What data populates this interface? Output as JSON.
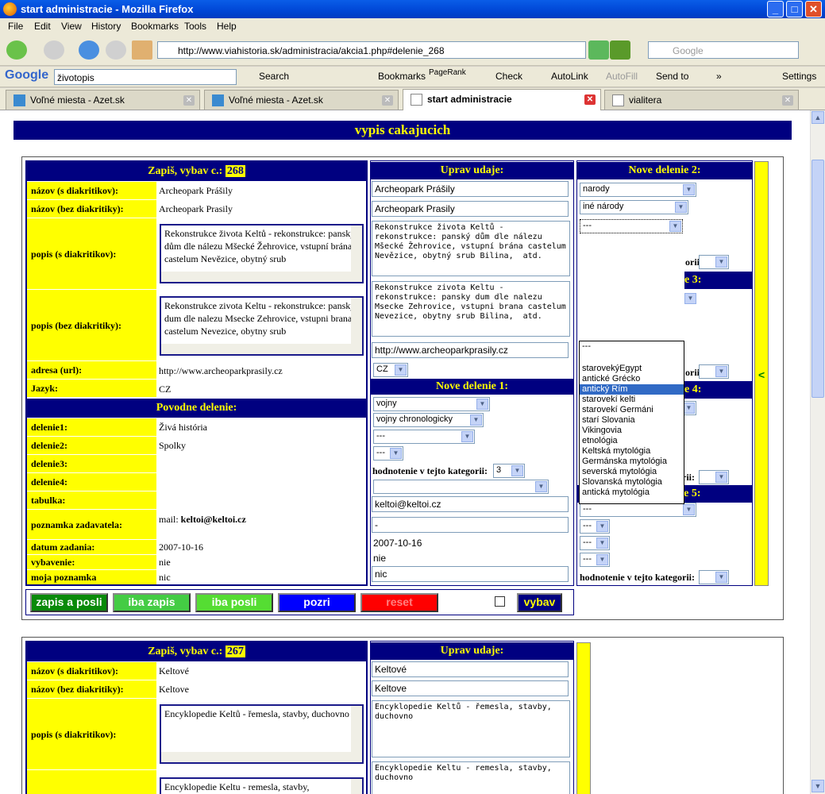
{
  "window": {
    "title": "start administracie - Mozilla Firefox"
  },
  "menu": [
    "File",
    "Edit",
    "View",
    "History",
    "Bookmarks",
    "Tools",
    "Help"
  ],
  "url": "http://www.viahistoria.sk/administracia/akcia1.php#delenie_268",
  "search_placeholder": "Google",
  "gtoolbar": {
    "query": "životopis",
    "search": "Search",
    "bookmarks": "Bookmarks",
    "pagerank": "PageRank",
    "check": "Check",
    "autolink": "AutoLink",
    "autofill": "AutoFill",
    "sendto": "Send to",
    "more": "»",
    "settings": "Settings"
  },
  "tabs": [
    "Voľné miesta - Azet.sk",
    "Voľné miesta - Azet.sk",
    "start administracie",
    "vialitera"
  ],
  "page": {
    "header": "vypis cakajucich"
  },
  "rec1": {
    "head_label": "Zapiš, vybav c.:",
    "num": "268",
    "l_nazov": "názov (s diakritikov):",
    "v_nazov": "Archeopark Prášily",
    "l_nazov2": "názov (bez diakritiky):",
    "v_nazov2": "Archeopark Prasily",
    "l_popis": "popis (s diakritikov):",
    "v_popis": "Rekonstrukce života Keltů - rekonstrukce: panský dům dle nálezu Mšecké Žehrovice, vstupní brána castelum Nevězice, obytný srub",
    "l_popis2": "popis (bez diakritiky):",
    "v_popis2": "Rekonstrukce zivota Keltu - rekonstrukce: pansky dum dle nalezu Msecke Zehrovice, vstupni brana castelum Nevezice, obytny srub",
    "l_url": "adresa (url):",
    "v_url": "http://www.archeoparkprasily.cz",
    "l_jazyk": "Jazyk:",
    "v_jazyk": "CZ",
    "povodne": "Povodne delenie:",
    "l_d1": "delenie1:",
    "v_d1": "Živá história",
    "l_d2": "delenie2:",
    "v_d2": "Spolky",
    "l_d3": "delenie3:",
    "l_d4": "delenie4:",
    "l_tab": "tabulka:",
    "l_pozn": "poznamka zadavatela:",
    "v_pozn_pre": "mail:",
    "v_pozn_mail": "keltoi@keltoi.cz",
    "l_datum": "datum zadania:",
    "v_datum": "2007-10-16",
    "l_vyb": "vybavenie:",
    "v_vyb": "nie",
    "l_moja": "moja poznamka",
    "v_moja": "nic",
    "uprav": "Uprav udaje:",
    "e_nazov": "Archeopark Prášily",
    "e_nazov2": "Archeopark Prasily",
    "e_popis": "Rekonstrukce života Keltů - rekonstrukce: panský dům dle nálezu Mšecké Žehrovice, vstupní brána castelum Nevězice, obytný srub Bilina,  atd.",
    "e_popis2": "Rekonstrukce zivota Keltu - rekonstrukce: pansky dum dle nalezu Msecke Zehrovice, vstupni brana castelum Nevezice, obytny srub Bilina,  atd.",
    "e_url": "http://www.archeoparkprasily.cz",
    "e_jazyk": "CZ",
    "nd1": "Nove delenie 1:",
    "nd1_s1": "vojny",
    "nd1_s2": "vojny chronologicky",
    "nd1_s3": "---",
    "nd1_s4": "---",
    "hodn": "hodnotenie v tejto kategorii:",
    "hodn_val": "3",
    "e_mail": "keltoi@keltoi.cz",
    "e_dash": "-",
    "e_datum": "2007-10-16",
    "e_vyb": "nie",
    "e_moja": "nic",
    "nd2": "Nove delenie 2:",
    "nd2_s1": "narody",
    "nd2_s2": "iné národy",
    "nd2_s3": "---",
    "nd3_partial": "e 3:",
    "nd4_partial": "e 4:",
    "hodn_partial": "orii:",
    "nd4_s1": "---",
    "nd4_s2": "---",
    "nd4_s3": "---",
    "nd4_s4": "---",
    "nd5": "Nove delenie 5:",
    "nd5_s1": "---",
    "nd5_s2": "---",
    "nd5_s3": "---",
    "nd5_s4": "---",
    "arrow": "<"
  },
  "dropdown": [
    "---",
    "",
    "starovekýEgypt",
    "antické Grécko",
    "antický Rím",
    "starovekí kelti",
    "starovekí Germáni",
    "starí Slovania",
    "Vikingovia",
    "etnológia",
    "Keltská mytológia",
    "Germánska mytológia",
    "severská mytológia",
    "Slovanská mytológia",
    "antická mytológia"
  ],
  "buttons": {
    "b1": "zapis a posli",
    "b2": "iba zapis",
    "b3": "iba posli",
    "b4": "pozri",
    "b5": "reset",
    "b6": "vybav"
  },
  "rec2": {
    "head_label": "Zapiš, vybav c.:",
    "num": "267",
    "v_nazov": "Keltové",
    "v_nazov2": "Keltove",
    "v_popis": "Encyklopedie Keltů - řemesla, stavby, duchovno",
    "v_popis2": "Encyklopedie Keltu - remesla, stavby,",
    "e_nazov": "Keltové",
    "e_nazov2": "Keltove",
    "e_popis": "Encyklopedie Keltů - řemesla, stavby, duchovno",
    "e_popis2": "Encyklopedie Keltu - remesla, stavby, duchovno"
  }
}
